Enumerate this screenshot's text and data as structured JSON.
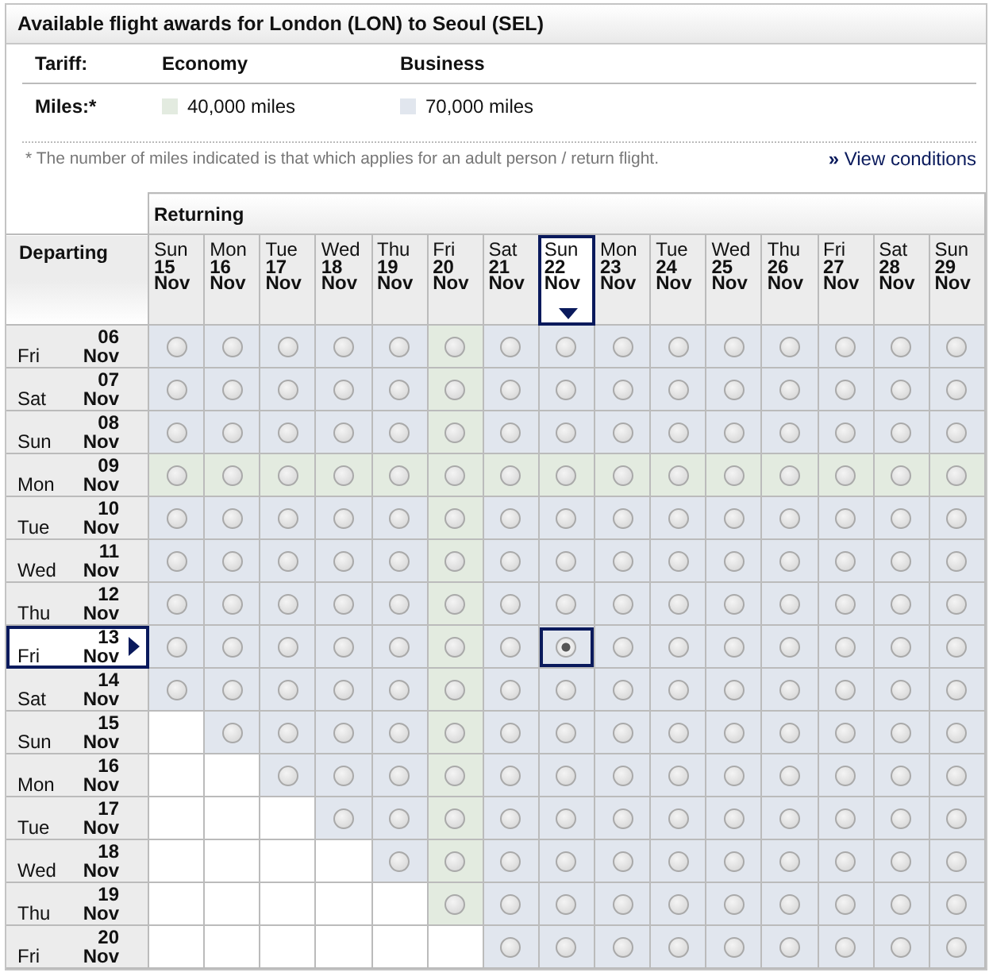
{
  "title": "Available flight awards for London (LON) to Seoul (SEL)",
  "tariff_label": "Tariff:",
  "miles_label": "Miles:*",
  "tariffs": [
    {
      "name": "Economy",
      "miles": "40,000 miles",
      "kind": "eco"
    },
    {
      "name": "Business",
      "miles": "70,000 miles",
      "kind": "bus"
    }
  ],
  "footnote": "* The number of miles indicated is that which applies for an adult person / return flight.",
  "conditions_link": "View conditions",
  "link_mark": "»",
  "returning_label": "Returning",
  "departing_label": "Departing",
  "columns": [
    {
      "weekday": "Sun",
      "day": "15",
      "month": "Nov",
      "selected": false
    },
    {
      "weekday": "Mon",
      "day": "16",
      "month": "Nov",
      "selected": false
    },
    {
      "weekday": "Tue",
      "day": "17",
      "month": "Nov",
      "selected": false
    },
    {
      "weekday": "Wed",
      "day": "18",
      "month": "Nov",
      "selected": false
    },
    {
      "weekday": "Thu",
      "day": "19",
      "month": "Nov",
      "selected": false
    },
    {
      "weekday": "Fri",
      "day": "20",
      "month": "Nov",
      "selected": false
    },
    {
      "weekday": "Sat",
      "day": "21",
      "month": "Nov",
      "selected": false
    },
    {
      "weekday": "Sun",
      "day": "22",
      "month": "Nov",
      "selected": true
    },
    {
      "weekday": "Mon",
      "day": "23",
      "month": "Nov",
      "selected": false
    },
    {
      "weekday": "Tue",
      "day": "24",
      "month": "Nov",
      "selected": false
    },
    {
      "weekday": "Wed",
      "day": "25",
      "month": "Nov",
      "selected": false
    },
    {
      "weekday": "Thu",
      "day": "26",
      "month": "Nov",
      "selected": false
    },
    {
      "weekday": "Fri",
      "day": "27",
      "month": "Nov",
      "selected": false
    },
    {
      "weekday": "Sat",
      "day": "28",
      "month": "Nov",
      "selected": false
    },
    {
      "weekday": "Sun",
      "day": "29",
      "month": "Nov",
      "selected": false
    }
  ],
  "rows": [
    {
      "weekday": "Fri",
      "day": "06",
      "month": "Nov",
      "selected": false,
      "fares": [
        {
          "kind": "bus"
        },
        {
          "kind": "bus"
        },
        {
          "kind": "bus"
        },
        {
          "kind": "bus"
        },
        {
          "kind": "bus"
        },
        {
          "kind": "eco"
        },
        {
          "kind": "bus"
        },
        {
          "kind": "bus"
        },
        {
          "kind": "bus"
        },
        {
          "kind": "bus"
        },
        {
          "kind": "bus"
        },
        {
          "kind": "bus"
        },
        {
          "kind": "bus"
        },
        {
          "kind": "bus"
        },
        {
          "kind": "bus"
        }
      ]
    },
    {
      "weekday": "Sat",
      "day": "07",
      "month": "Nov",
      "selected": false,
      "fares": [
        {
          "kind": "bus"
        },
        {
          "kind": "bus"
        },
        {
          "kind": "bus"
        },
        {
          "kind": "bus"
        },
        {
          "kind": "bus"
        },
        {
          "kind": "eco"
        },
        {
          "kind": "bus"
        },
        {
          "kind": "bus"
        },
        {
          "kind": "bus"
        },
        {
          "kind": "bus"
        },
        {
          "kind": "bus"
        },
        {
          "kind": "bus"
        },
        {
          "kind": "bus"
        },
        {
          "kind": "bus"
        },
        {
          "kind": "bus"
        }
      ]
    },
    {
      "weekday": "Sun",
      "day": "08",
      "month": "Nov",
      "selected": false,
      "fares": [
        {
          "kind": "bus"
        },
        {
          "kind": "bus"
        },
        {
          "kind": "bus"
        },
        {
          "kind": "bus"
        },
        {
          "kind": "bus"
        },
        {
          "kind": "eco"
        },
        {
          "kind": "bus"
        },
        {
          "kind": "bus"
        },
        {
          "kind": "bus"
        },
        {
          "kind": "bus"
        },
        {
          "kind": "bus"
        },
        {
          "kind": "bus"
        },
        {
          "kind": "bus"
        },
        {
          "kind": "bus"
        },
        {
          "kind": "bus"
        }
      ]
    },
    {
      "weekday": "Mon",
      "day": "09",
      "month": "Nov",
      "selected": false,
      "fares": [
        {
          "kind": "eco"
        },
        {
          "kind": "eco"
        },
        {
          "kind": "eco"
        },
        {
          "kind": "eco"
        },
        {
          "kind": "eco"
        },
        {
          "kind": "eco"
        },
        {
          "kind": "eco"
        },
        {
          "kind": "eco"
        },
        {
          "kind": "eco"
        },
        {
          "kind": "eco"
        },
        {
          "kind": "eco"
        },
        {
          "kind": "eco"
        },
        {
          "kind": "eco"
        },
        {
          "kind": "eco"
        },
        {
          "kind": "eco"
        }
      ]
    },
    {
      "weekday": "Tue",
      "day": "10",
      "month": "Nov",
      "selected": false,
      "fares": [
        {
          "kind": "bus"
        },
        {
          "kind": "bus"
        },
        {
          "kind": "bus"
        },
        {
          "kind": "bus"
        },
        {
          "kind": "bus"
        },
        {
          "kind": "eco"
        },
        {
          "kind": "bus"
        },
        {
          "kind": "bus"
        },
        {
          "kind": "bus"
        },
        {
          "kind": "bus"
        },
        {
          "kind": "bus"
        },
        {
          "kind": "bus"
        },
        {
          "kind": "bus"
        },
        {
          "kind": "bus"
        },
        {
          "kind": "bus"
        }
      ]
    },
    {
      "weekday": "Wed",
      "day": "11",
      "month": "Nov",
      "selected": false,
      "fares": [
        {
          "kind": "bus"
        },
        {
          "kind": "bus"
        },
        {
          "kind": "bus"
        },
        {
          "kind": "bus"
        },
        {
          "kind": "bus"
        },
        {
          "kind": "eco"
        },
        {
          "kind": "bus"
        },
        {
          "kind": "bus"
        },
        {
          "kind": "bus"
        },
        {
          "kind": "bus"
        },
        {
          "kind": "bus"
        },
        {
          "kind": "bus"
        },
        {
          "kind": "bus"
        },
        {
          "kind": "bus"
        },
        {
          "kind": "bus"
        }
      ]
    },
    {
      "weekday": "Thu",
      "day": "12",
      "month": "Nov",
      "selected": false,
      "fares": [
        {
          "kind": "bus"
        },
        {
          "kind": "bus"
        },
        {
          "kind": "bus"
        },
        {
          "kind": "bus"
        },
        {
          "kind": "bus"
        },
        {
          "kind": "eco"
        },
        {
          "kind": "bus"
        },
        {
          "kind": "bus"
        },
        {
          "kind": "bus"
        },
        {
          "kind": "bus"
        },
        {
          "kind": "bus"
        },
        {
          "kind": "bus"
        },
        {
          "kind": "bus"
        },
        {
          "kind": "bus"
        },
        {
          "kind": "bus"
        }
      ]
    },
    {
      "weekday": "Fri",
      "day": "13",
      "month": "Nov",
      "selected": true,
      "fares": [
        {
          "kind": "bus"
        },
        {
          "kind": "bus"
        },
        {
          "kind": "bus"
        },
        {
          "kind": "bus"
        },
        {
          "kind": "bus"
        },
        {
          "kind": "eco"
        },
        {
          "kind": "bus"
        },
        {
          "kind": "bus"
        },
        {
          "kind": "bus"
        },
        {
          "kind": "bus"
        },
        {
          "kind": "bus"
        },
        {
          "kind": "bus"
        },
        {
          "kind": "bus"
        },
        {
          "kind": "bus"
        },
        {
          "kind": "bus"
        }
      ]
    },
    {
      "weekday": "Sat",
      "day": "14",
      "month": "Nov",
      "selected": false,
      "fares": [
        {
          "kind": "bus"
        },
        {
          "kind": "bus"
        },
        {
          "kind": "bus"
        },
        {
          "kind": "bus"
        },
        {
          "kind": "bus"
        },
        {
          "kind": "eco"
        },
        {
          "kind": "bus"
        },
        {
          "kind": "bus"
        },
        {
          "kind": "bus"
        },
        {
          "kind": "bus"
        },
        {
          "kind": "bus"
        },
        {
          "kind": "bus"
        },
        {
          "kind": "bus"
        },
        {
          "kind": "bus"
        },
        {
          "kind": "bus"
        }
      ]
    },
    {
      "weekday": "Sun",
      "day": "15",
      "month": "Nov",
      "selected": false,
      "fares": [
        {
          "kind": "none"
        },
        {
          "kind": "bus"
        },
        {
          "kind": "bus"
        },
        {
          "kind": "bus"
        },
        {
          "kind": "bus"
        },
        {
          "kind": "eco"
        },
        {
          "kind": "bus"
        },
        {
          "kind": "bus"
        },
        {
          "kind": "bus"
        },
        {
          "kind": "bus"
        },
        {
          "kind": "bus"
        },
        {
          "kind": "bus"
        },
        {
          "kind": "bus"
        },
        {
          "kind": "bus"
        },
        {
          "kind": "bus"
        }
      ]
    },
    {
      "weekday": "Mon",
      "day": "16",
      "month": "Nov",
      "selected": false,
      "fares": [
        {
          "kind": "none"
        },
        {
          "kind": "none"
        },
        {
          "kind": "bus"
        },
        {
          "kind": "bus"
        },
        {
          "kind": "bus"
        },
        {
          "kind": "eco"
        },
        {
          "kind": "bus"
        },
        {
          "kind": "bus"
        },
        {
          "kind": "bus"
        },
        {
          "kind": "bus"
        },
        {
          "kind": "bus"
        },
        {
          "kind": "bus"
        },
        {
          "kind": "bus"
        },
        {
          "kind": "bus"
        },
        {
          "kind": "bus"
        }
      ]
    },
    {
      "weekday": "Tue",
      "day": "17",
      "month": "Nov",
      "selected": false,
      "fares": [
        {
          "kind": "none"
        },
        {
          "kind": "none"
        },
        {
          "kind": "none"
        },
        {
          "kind": "bus"
        },
        {
          "kind": "bus"
        },
        {
          "kind": "eco"
        },
        {
          "kind": "bus"
        },
        {
          "kind": "bus"
        },
        {
          "kind": "bus"
        },
        {
          "kind": "bus"
        },
        {
          "kind": "bus"
        },
        {
          "kind": "bus"
        },
        {
          "kind": "bus"
        },
        {
          "kind": "bus"
        },
        {
          "kind": "bus"
        }
      ]
    },
    {
      "weekday": "Wed",
      "day": "18",
      "month": "Nov",
      "selected": false,
      "fares": [
        {
          "kind": "none"
        },
        {
          "kind": "none"
        },
        {
          "kind": "none"
        },
        {
          "kind": "none"
        },
        {
          "kind": "bus"
        },
        {
          "kind": "eco"
        },
        {
          "kind": "bus"
        },
        {
          "kind": "bus"
        },
        {
          "kind": "bus"
        },
        {
          "kind": "bus"
        },
        {
          "kind": "bus"
        },
        {
          "kind": "bus"
        },
        {
          "kind": "bus"
        },
        {
          "kind": "bus"
        },
        {
          "kind": "bus"
        }
      ]
    },
    {
      "weekday": "Thu",
      "day": "19",
      "month": "Nov",
      "selected": false,
      "fares": [
        {
          "kind": "none"
        },
        {
          "kind": "none"
        },
        {
          "kind": "none"
        },
        {
          "kind": "none"
        },
        {
          "kind": "none"
        },
        {
          "kind": "eco"
        },
        {
          "kind": "bus"
        },
        {
          "kind": "bus"
        },
        {
          "kind": "bus"
        },
        {
          "kind": "bus"
        },
        {
          "kind": "bus"
        },
        {
          "kind": "bus"
        },
        {
          "kind": "bus"
        },
        {
          "kind": "bus"
        },
        {
          "kind": "bus"
        }
      ]
    },
    {
      "weekday": "Fri",
      "day": "20",
      "month": "Nov",
      "selected": false,
      "fares": [
        {
          "kind": "none"
        },
        {
          "kind": "none"
        },
        {
          "kind": "none"
        },
        {
          "kind": "none"
        },
        {
          "kind": "none"
        },
        {
          "kind": "none"
        },
        {
          "kind": "bus"
        },
        {
          "kind": "bus"
        },
        {
          "kind": "bus"
        },
        {
          "kind": "bus"
        },
        {
          "kind": "bus"
        },
        {
          "kind": "bus"
        },
        {
          "kind": "bus"
        },
        {
          "kind": "bus"
        },
        {
          "kind": "bus"
        }
      ]
    }
  ]
}
